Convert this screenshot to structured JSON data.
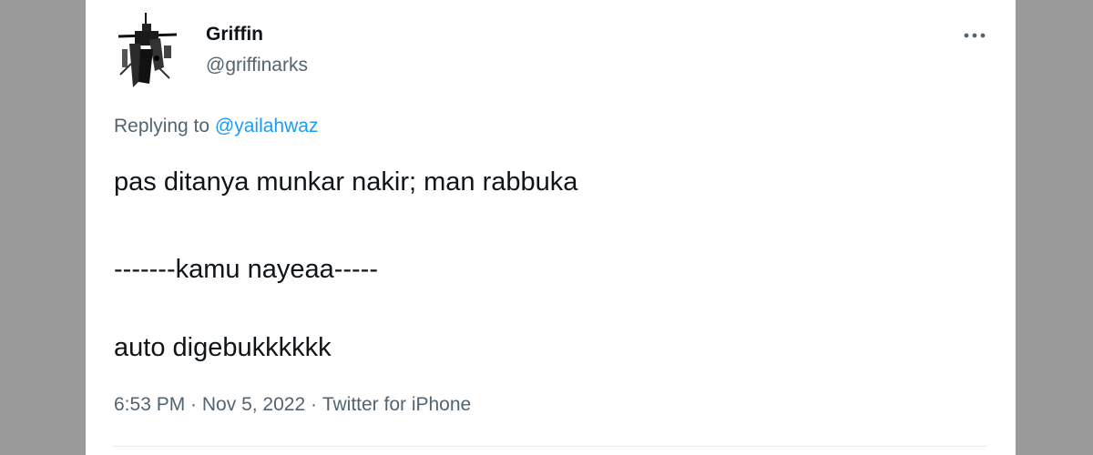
{
  "user": {
    "name": "Griffin",
    "handle": "@griffinarks"
  },
  "reply": {
    "prefix": "Replying to ",
    "mention": "@yailahwaz"
  },
  "tweet": {
    "lines": [
      "pas ditanya munkar nakir; man rabbuka",
      "-------kamu nayeaa-----",
      "auto digebukkkkkk"
    ]
  },
  "meta": {
    "time": "6:53 PM",
    "separator": " · ",
    "date": "Nov 5, 2022",
    "source": "Twitter for iPhone"
  },
  "icons": {
    "more": "more-options-icon",
    "avatar": "avatar-image"
  },
  "colors": {
    "background": "#9a9a9a",
    "card": "#ffffff",
    "primary_text": "#0f1419",
    "secondary_text": "#536471",
    "accent": "#1d9bf0"
  }
}
